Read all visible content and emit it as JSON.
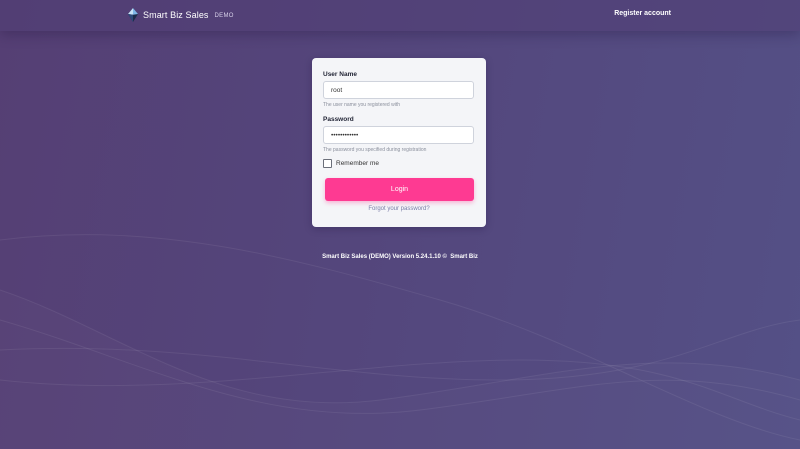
{
  "header": {
    "brand_name": "Smart Biz Sales",
    "brand_badge": "DEMO",
    "register_label": "Register account"
  },
  "login": {
    "username_label": "User Name",
    "username_value": "root",
    "username_help": "The user name you registered with",
    "password_label": "Password",
    "password_value": "••••••••••••",
    "password_help": "The password you specified during registration",
    "remember_label": "Remember me",
    "remember_checked": false,
    "login_label": "Login",
    "forgot_label": "Forgot your password?"
  },
  "footer": {
    "version_text": "Smart Biz Sales (DEMO) Version 5.24.1.10 ©",
    "company": "Smart Biz"
  },
  "colors": {
    "accent": "#fe3a92",
    "background": "#54467c"
  }
}
